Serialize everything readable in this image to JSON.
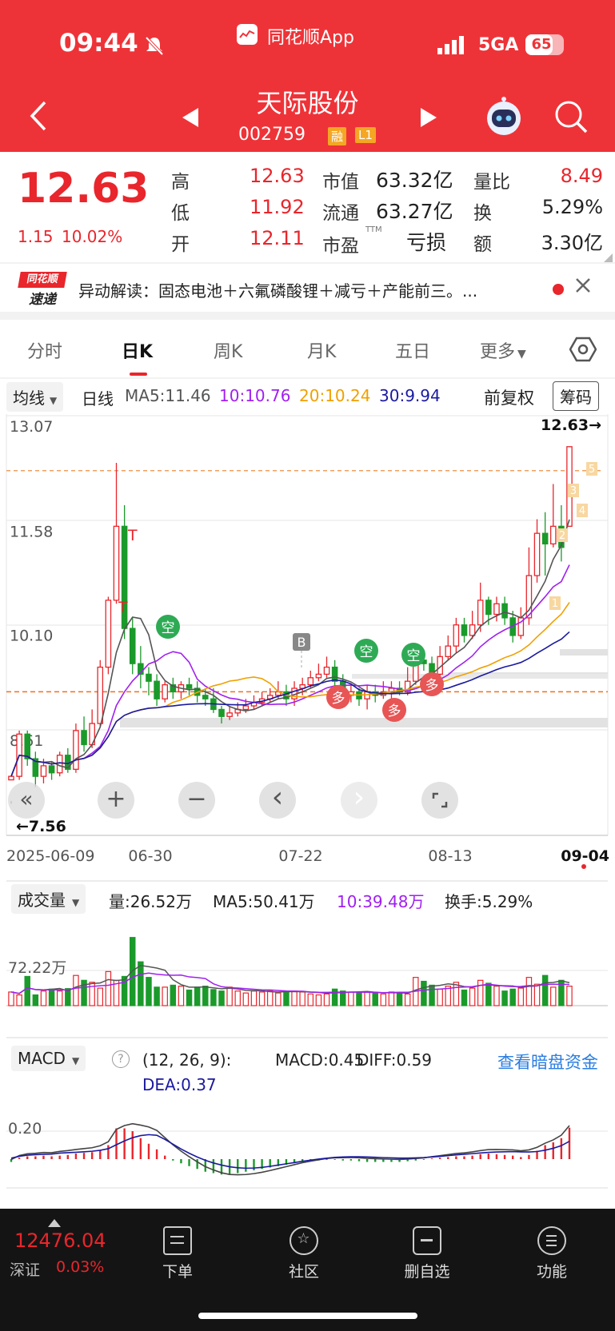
{
  "status": {
    "time": "09:44",
    "app_name": "同花顺App",
    "network": "5GA",
    "battery": "65"
  },
  "header": {
    "title": "天际股份",
    "code": "002759",
    "badge1": "融",
    "badge2": "L1"
  },
  "quote": {
    "price": "12.63",
    "change": "1.15",
    "change_pct": "10.02%",
    "rows": [
      {
        "l1": "高",
        "v1": "12.63",
        "l2": "市值",
        "v2": "63.32亿",
        "l3": "量比",
        "v3": "8.49"
      },
      {
        "l1": "低",
        "v1": "11.92",
        "l2": "流通",
        "v2": "63.27亿",
        "l3": "换",
        "v3": "5.29%"
      },
      {
        "l1": "开",
        "v1": "12.11",
        "l2": "市盈",
        "v2": "亏损",
        "l3": "额",
        "v3": "3.30亿"
      }
    ],
    "ttm": "TTM",
    "red_color": "#e8262c",
    "green_color": "#1a9a2a"
  },
  "news": {
    "logo_top": "同花顺",
    "logo_bottom": "速递",
    "text": "异动解读：固态电池＋六氟磷酸锂＋减亏＋产能前三。..."
  },
  "tabs": [
    "分时",
    "日K",
    "周K",
    "月K",
    "五日",
    "更多"
  ],
  "active_tab": "日K",
  "ma_bar": {
    "type": "均线",
    "period": "日线",
    "ma5": "MA5:11.46",
    "ma10": "10:10.76",
    "ma20": "20:10.24",
    "ma30": "30:9.94",
    "adjust": "前复权",
    "chips": "筹码",
    "colors": {
      "ma5": "#555555",
      "ma10": "#a020f0",
      "ma20": "#f0a000",
      "ma30": "#1a1aa0"
    }
  },
  "chart_data": {
    "type": "candlestick",
    "price_axis": {
      "ticks": [
        "13.07",
        "11.58",
        "10.10",
        "8.61"
      ],
      "values": [
        13.07,
        11.58,
        10.1,
        8.61
      ],
      "ylim": [
        7.5,
        13.35
      ]
    },
    "last_price_label": "12.63→",
    "low_label": "←7.56",
    "dates": [
      "2025-06-09",
      "06-30",
      "07-22",
      "08-13",
      "09-04"
    ],
    "markers": {
      "t": "T",
      "b": "B",
      "short": "空",
      "long": "多",
      "wave": [
        "1",
        "2",
        "3",
        "4",
        "5"
      ]
    },
    "candles": [
      [
        7.9,
        7.95,
        7.6,
        7.56
      ],
      [
        7.95,
        8.55,
        8.6,
        7.9
      ],
      [
        8.55,
        8.2,
        8.6,
        8.1
      ],
      [
        8.2,
        7.95,
        8.3,
        7.8
      ],
      [
        7.95,
        8.1,
        8.2,
        7.85
      ],
      [
        8.1,
        8.0,
        8.15,
        7.9
      ],
      [
        8.0,
        8.25,
        8.3,
        7.95
      ],
      [
        8.25,
        8.05,
        8.35,
        8.0
      ],
      [
        8.05,
        8.6,
        8.7,
        8.0
      ],
      [
        8.6,
        8.4,
        8.8,
        8.3
      ],
      [
        8.4,
        8.7,
        8.9,
        8.35
      ],
      [
        8.7,
        9.5,
        9.6,
        8.65
      ],
      [
        9.5,
        10.45,
        10.5,
        9.4
      ],
      [
        10.45,
        11.5,
        12.4,
        10.4
      ],
      [
        11.5,
        10.05,
        11.8,
        9.9
      ],
      [
        10.05,
        9.55,
        10.2,
        9.4
      ],
      [
        9.55,
        9.4,
        9.8,
        9.2
      ],
      [
        9.4,
        9.3,
        9.5,
        9.1
      ],
      [
        9.3,
        9.05,
        9.4,
        8.95
      ],
      [
        9.05,
        9.25,
        9.3,
        9.0
      ],
      [
        9.25,
        9.15,
        9.35,
        9.05
      ],
      [
        9.15,
        9.25,
        9.3,
        9.05
      ],
      [
        9.25,
        9.2,
        9.35,
        9.1
      ],
      [
        9.2,
        9.1,
        9.3,
        9.0
      ],
      [
        9.1,
        9.05,
        9.2,
        8.95
      ],
      [
        9.05,
        8.9,
        9.2,
        8.85
      ],
      [
        8.9,
        8.8,
        8.95,
        8.7
      ],
      [
        8.8,
        8.85,
        8.95,
        8.75
      ],
      [
        8.85,
        8.9,
        9.0,
        8.8
      ],
      [
        8.9,
        8.95,
        9.05,
        8.85
      ],
      [
        8.95,
        9.0,
        9.1,
        8.9
      ],
      [
        9.0,
        9.05,
        9.15,
        8.95
      ],
      [
        9.05,
        9.1,
        9.2,
        9.0
      ],
      [
        9.1,
        9.15,
        9.3,
        9.05
      ],
      [
        9.15,
        9.05,
        9.25,
        8.95
      ],
      [
        9.05,
        9.2,
        9.3,
        8.95
      ],
      [
        9.2,
        9.25,
        9.35,
        9.1
      ],
      [
        9.25,
        9.35,
        9.45,
        9.2
      ],
      [
        9.35,
        9.4,
        9.55,
        9.3
      ],
      [
        9.4,
        9.5,
        9.65,
        9.35
      ],
      [
        9.5,
        9.3,
        9.6,
        9.2
      ],
      [
        9.3,
        9.1,
        9.4,
        9.0
      ],
      [
        9.1,
        9.15,
        9.25,
        9.0
      ],
      [
        9.15,
        9.05,
        9.2,
        8.95
      ],
      [
        9.05,
        9.15,
        9.25,
        8.9
      ],
      [
        9.15,
        9.1,
        9.25,
        9.0
      ],
      [
        9.1,
        9.15,
        9.3,
        9.05
      ],
      [
        9.15,
        9.2,
        9.3,
        9.05
      ],
      [
        9.2,
        9.15,
        9.3,
        9.1
      ],
      [
        9.15,
        9.3,
        9.5,
        9.1
      ],
      [
        9.3,
        9.6,
        9.8,
        9.25
      ],
      [
        9.6,
        9.55,
        9.75,
        9.45
      ],
      [
        9.55,
        9.4,
        9.65,
        9.3
      ],
      [
        9.4,
        9.65,
        9.8,
        9.35
      ],
      [
        9.65,
        9.8,
        9.95,
        9.6
      ],
      [
        9.8,
        10.1,
        10.2,
        9.7
      ],
      [
        10.1,
        9.95,
        10.2,
        9.85
      ],
      [
        9.95,
        10.1,
        10.3,
        9.9
      ],
      [
        10.1,
        10.45,
        10.7,
        10.0
      ],
      [
        10.45,
        10.25,
        10.5,
        10.1
      ],
      [
        10.25,
        10.4,
        10.5,
        10.15
      ],
      [
        10.4,
        10.2,
        10.5,
        10.1
      ],
      [
        10.2,
        9.95,
        10.3,
        9.85
      ],
      [
        9.95,
        10.2,
        10.35,
        9.9
      ],
      [
        10.2,
        10.8,
        11.2,
        10.1
      ],
      [
        10.8,
        11.4,
        11.6,
        10.7
      ],
      [
        11.4,
        11.25,
        11.7,
        10.8
      ],
      [
        11.25,
        11.5,
        12.1,
        11.2
      ],
      [
        11.5,
        11.2,
        11.8,
        11.0
      ],
      [
        11.5,
        12.63,
        12.63,
        11.92
      ]
    ],
    "volume": {
      "label": "成交量",
      "vol": "量:26.52万",
      "ma5": "MA5:50.41万",
      "ma10": "10:39.48万",
      "turnover": "换手:5.29%",
      "axis_label": "72.22万",
      "axis_value": 72.22
    },
    "volumes": [
      28,
      22,
      60,
      22,
      30,
      34,
      30,
      35,
      62,
      52,
      48,
      36,
      70,
      52,
      60,
      140,
      90,
      58,
      38,
      38,
      42,
      40,
      32,
      38,
      40,
      33,
      30,
      38,
      30,
      26,
      30,
      28,
      30,
      26,
      30,
      30,
      28,
      24,
      22,
      24,
      34,
      30,
      28,
      26,
      28,
      26,
      24,
      28,
      26,
      24,
      58,
      50,
      42,
      34,
      40,
      48,
      32,
      36,
      52,
      46,
      40,
      30,
      34,
      36,
      58,
      44,
      62,
      38,
      52,
      40
    ],
    "macd": {
      "label": "MACD",
      "params": "(12, 26, 9):",
      "macd": "MACD:0.45",
      "diff": "DIFF:0.59",
      "dea": "DEA:0.37",
      "link": "查看暗盘资金",
      "axis_label": "0.20",
      "axis_value": 0.2
    },
    "macd_bars": [
      -0.04,
      0.02,
      0.04,
      0.04,
      0.05,
      0.04,
      0.05,
      0.06,
      0.08,
      0.09,
      0.1,
      0.13,
      0.2,
      0.44,
      0.44,
      0.4,
      0.3,
      0.22,
      0.14,
      0.05,
      -0.02,
      -0.06,
      -0.1,
      -0.14,
      -0.18,
      -0.2,
      -0.22,
      -0.22,
      -0.2,
      -0.18,
      -0.16,
      -0.14,
      -0.12,
      -0.1,
      -0.08,
      -0.06,
      -0.04,
      -0.03,
      -0.02,
      -0.01,
      -0.01,
      -0.02,
      -0.02,
      -0.03,
      -0.04,
      -0.04,
      -0.04,
      -0.04,
      -0.04,
      -0.03,
      -0.02,
      -0.01,
      0.01,
      0.02,
      0.03,
      0.04,
      0.04,
      0.05,
      0.07,
      0.08,
      0.07,
      0.06,
      0.05,
      0.03,
      0.06,
      0.12,
      0.2,
      0.24,
      0.3,
      0.45
    ]
  },
  "chart_buttons": {
    "zoom_in": "+",
    "zoom_out": "−",
    "prev": "‹",
    "next": "›"
  },
  "bottom": {
    "index_value": "12476.04",
    "index_name": "深证",
    "index_change": "0.03%",
    "nav": [
      {
        "label": "下单",
        "icon": "order-icon"
      },
      {
        "label": "社区",
        "icon": "community-icon"
      },
      {
        "label": "删自选",
        "icon": "remove-watchlist-icon"
      },
      {
        "label": "功能",
        "icon": "menu-icon"
      }
    ]
  }
}
